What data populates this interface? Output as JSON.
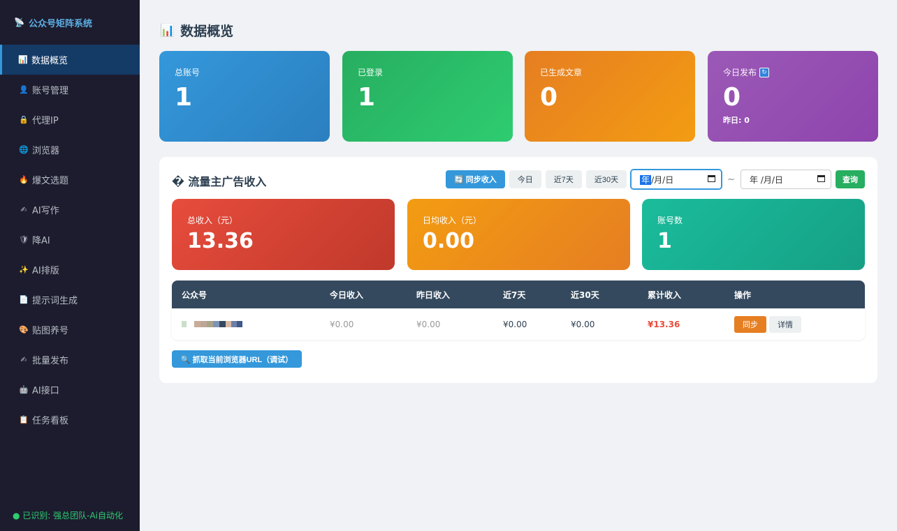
{
  "sidebar": {
    "brand": {
      "icon": "📡",
      "title": "公众号矩阵系统"
    },
    "items": [
      {
        "icon": "📊",
        "label": "数据概览",
        "active": true
      },
      {
        "icon": "👤",
        "label": "账号管理"
      },
      {
        "icon": "🔒",
        "label": "代理IP"
      },
      {
        "icon": "🌐",
        "label": "浏览器"
      },
      {
        "icon": "🔥",
        "label": "爆文选题"
      },
      {
        "icon": "✍",
        "label": "AI写作"
      },
      {
        "icon": "🛡",
        "label": "降AI"
      },
      {
        "icon": "✨",
        "label": "AI排版"
      },
      {
        "icon": "📄",
        "label": "提示词生成"
      },
      {
        "icon": "🎨",
        "label": "贴图养号"
      },
      {
        "icon": "✍",
        "label": "批量发布"
      },
      {
        "icon": "🤖",
        "label": "AI接口"
      },
      {
        "icon": "📋",
        "label": "任务看板"
      }
    ],
    "status": "● 已识别: 强总团队-Ai自动化"
  },
  "page": {
    "icon": "📊",
    "title": "数据概览"
  },
  "stats": [
    {
      "label": "总账号",
      "value": "1"
    },
    {
      "label": "已登录",
      "value": "1"
    },
    {
      "label": "已生成文章",
      "value": "0"
    },
    {
      "label": "今日发布",
      "value": "0",
      "sub": "昨日: 0",
      "badge": "🔄"
    }
  ],
  "income": {
    "title": "� 流量主广告收入",
    "toolbar": {
      "sync": "🔄 同步收入",
      "today": "今日",
      "week": "近7天",
      "month": "近30天",
      "date_start": {
        "year": "年",
        "rest": "/月/日"
      },
      "separator": "~",
      "date_end": "年 /月/日",
      "query": "查询"
    },
    "cards": [
      {
        "label": "总收入（元）",
        "value": "13.36"
      },
      {
        "label": "日均收入（元）",
        "value": "0.00"
      },
      {
        "label": "账号数",
        "value": "1"
      }
    ],
    "table": {
      "headers": [
        "公众号",
        "今日收入",
        "昨日收入",
        "近7天",
        "近30天",
        "累计收入",
        "操作"
      ],
      "rows": [
        {
          "today": "¥0.00",
          "yesterday": "¥0.00",
          "week": "¥0.00",
          "month": "¥0.00",
          "total": "¥13.36",
          "sync": "同步",
          "detail": "详情"
        }
      ]
    },
    "fetch_button": "🔍 抓取当前浏览器URL（调试）"
  }
}
